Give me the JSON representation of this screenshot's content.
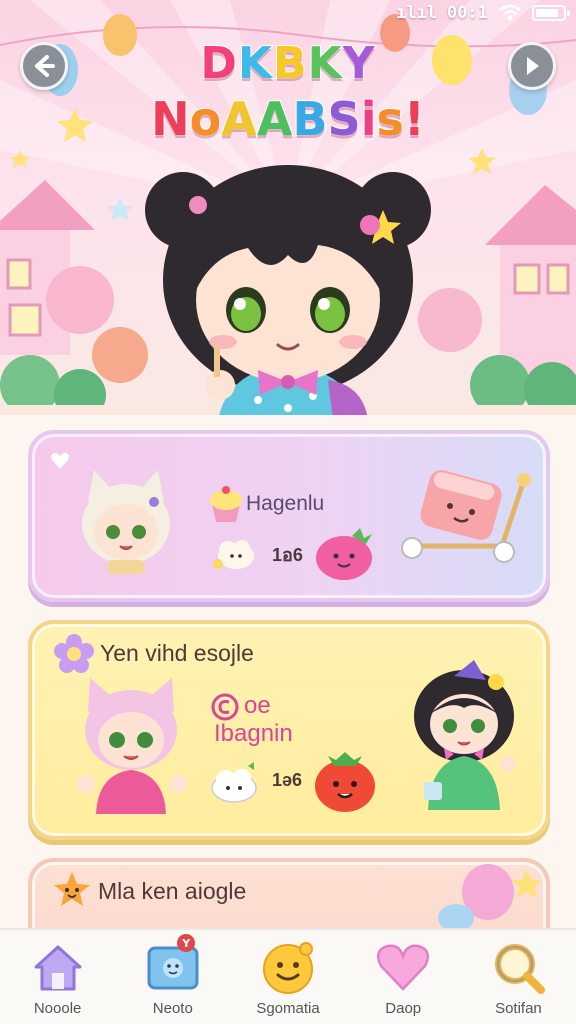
{
  "status_bar": {
    "signal": "ılıl",
    "time": "00:1"
  },
  "header": {
    "title_line1": [
      {
        "ch": "D",
        "color": "#f2407a"
      },
      {
        "ch": "K",
        "color": "#3fb9e8"
      },
      {
        "ch": "B",
        "color": "#f8c829"
      },
      {
        "ch": "K",
        "color": "#59c45e"
      },
      {
        "ch": "Y",
        "color": "#a65ad8"
      }
    ],
    "title_line2": [
      {
        "ch": "N",
        "color": "#ef3e59"
      },
      {
        "ch": "o",
        "color": "#f58d2b"
      },
      {
        "ch": "A",
        "color": "#f2c42d"
      },
      {
        "ch": "A",
        "color": "#4dbf5d"
      },
      {
        "ch": "B",
        "color": "#39a9e5"
      },
      {
        "ch": "S",
        "color": "#8d5ad8"
      },
      {
        "ch": "i",
        "color": "#ef3e88"
      },
      {
        "ch": "s",
        "color": "#f58d2b"
      },
      {
        "ch": "!",
        "color": "#ef3e59"
      }
    ],
    "back_icon": "arrow-left-icon",
    "forward_icon": "arrow-right-icon"
  },
  "cards": [
    {
      "label": "Hagenlu",
      "score": "1อ6"
    },
    {
      "title": "Yen vihd esojle",
      "text_line1": "oe",
      "text_line2": "Ibagnin",
      "score": "1ə6"
    },
    {
      "title": "Mla ken aiogle"
    }
  ],
  "bottom_nav": [
    {
      "label": "Nooole",
      "icon": "home-icon"
    },
    {
      "label": "Neoto",
      "icon": "tv-icon",
      "badge": "Y"
    },
    {
      "label": "Sgomatia",
      "icon": "smiley-icon"
    },
    {
      "label": "Daop",
      "icon": "heart-icon"
    },
    {
      "label": "Sotifan",
      "icon": "search-icon"
    }
  ],
  "colors": {
    "card1": "#f3cdee",
    "card2": "#fff0a8",
    "card3": "#fcdccf",
    "accent_pink": "#d9459a"
  }
}
